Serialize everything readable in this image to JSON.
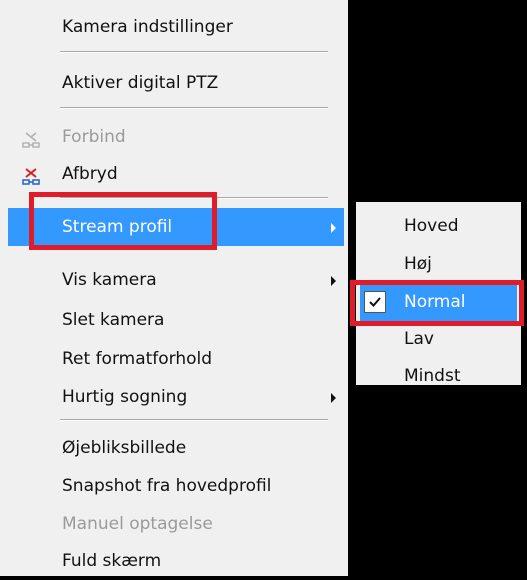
{
  "menu": {
    "items": {
      "kamera_indstillinger": "Kamera indstillinger",
      "aktiver_digital_ptz": "Aktiver digital PTZ",
      "forbind": "Forbind",
      "afbryd": "Afbryd",
      "stream_profil": "Stream profil",
      "vis_kamera": "Vis kamera",
      "slet_kamera": "Slet kamera",
      "ret_formatforhold": "Ret formatforhold",
      "hurtig_sogning": "Hurtig sogning",
      "ojebliksbillede": "Øjebliksbillede",
      "snapshot_fra_hovedprofil": "Snapshot fra hovedprofil",
      "manuel_optagelse": "Manuel optagelse",
      "fuld_skaerm": "Fuld skærm"
    },
    "highlighted_item": "Stream profil",
    "highlight_color": "#3399ff",
    "disabled_items": [
      "Forbind",
      "Manuel optagelse"
    ],
    "icons": {
      "forbind": "connect-icon",
      "afbryd": "disconnect-icon"
    }
  },
  "submenu": {
    "items": {
      "hoved": "Hoved",
      "hoj": "Høj",
      "normal": "Normal",
      "lav": "Lav",
      "mindst": "Mindst"
    },
    "selected": "Normal",
    "checked_icon": "checkmark-icon"
  },
  "annotation_color": "#e01b2a"
}
